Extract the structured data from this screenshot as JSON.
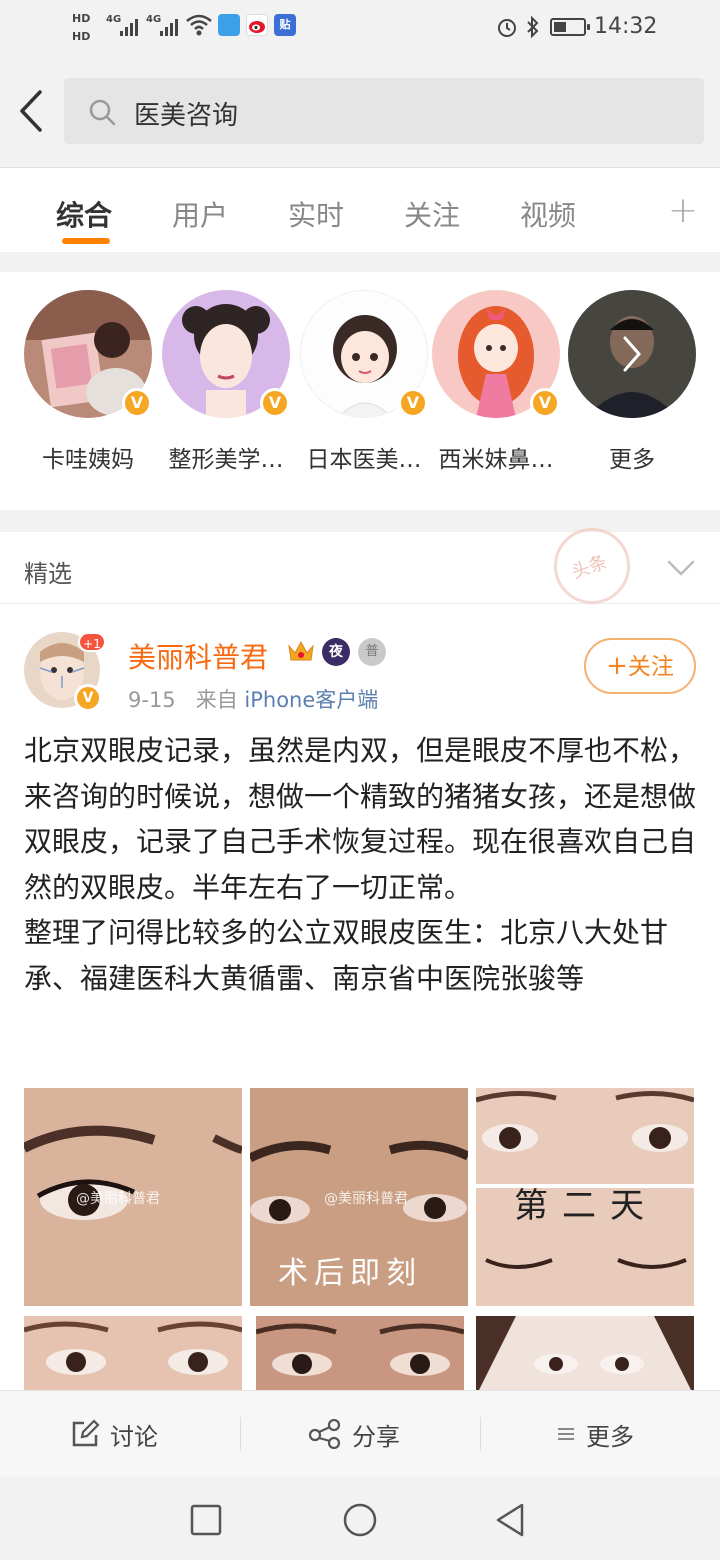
{
  "status_bar": {
    "hd1": "HD",
    "hd2": "HD",
    "signal1": "4G",
    "signal2": "4G",
    "time": "14:32"
  },
  "search": {
    "query": "医美咨询"
  },
  "tabs": [
    {
      "label": "综合",
      "active": true
    },
    {
      "label": "用户",
      "active": false
    },
    {
      "label": "实时",
      "active": false
    },
    {
      "label": "关注",
      "active": false
    },
    {
      "label": "视频",
      "active": false
    }
  ],
  "tab_add": "+",
  "users": [
    {
      "name": "卡哇姨妈",
      "verified": "V"
    },
    {
      "name": "整形美学…",
      "verified": "V"
    },
    {
      "name": "日本医美…",
      "verified": "V"
    },
    {
      "name": "西米妹鼻…",
      "verified": "V"
    },
    {
      "name": "更多"
    }
  ],
  "featured": {
    "label": "精选",
    "stamp": "头条"
  },
  "post": {
    "author": "美丽科普君",
    "plus_badge": "+1",
    "verified": "V",
    "night_badge": "夜",
    "silver_badge": "普",
    "date": "9-15",
    "source_prefix": "来自",
    "source": "iPhone客户端",
    "follow_label": "关注",
    "paragraph1": "北京双眼皮记录，虽然是内双，但是眼皮不厚也不松，来咨询的时候说，想做一个精致的猪猪女孩，还是想做双眼皮，记录了自己手术恢复过程。现在很喜欢自己自然的双眼皮。半年左右了一切正常。",
    "paragraph2": "整理了问得比较多的公立双眼皮医生：北京八大处甘承、福建医科大黄循雷、南京省中医院张骏等",
    "images": [
      {
        "watermark": "@美丽科普君",
        "caption": ""
      },
      {
        "watermark": "@美丽科普君",
        "caption": "术后即刻"
      },
      {
        "watermark": "",
        "caption": "第二天"
      }
    ]
  },
  "actions": {
    "comment": "讨论",
    "share": "分享",
    "more": "更多"
  },
  "colors": {
    "accent": "#ff8200",
    "author": "#f86a11",
    "link": "#5b7fb0",
    "verified": "#f5a623"
  }
}
